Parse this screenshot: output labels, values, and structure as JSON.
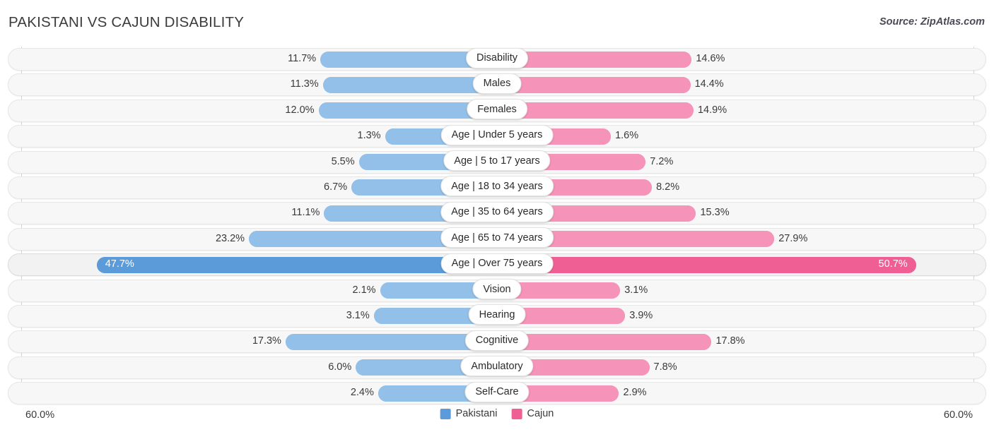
{
  "header": {
    "title": "PAKISTANI VS CAJUN DISABILITY",
    "source": "Source: ZipAtlas.com"
  },
  "axis": {
    "left_label": "60.0%",
    "right_label": "60.0%",
    "max": 60.0
  },
  "legend": {
    "items": [
      {
        "label": "Pakistani",
        "color": "#5b9bd9"
      },
      {
        "label": "Cajun",
        "color": "#f05f93"
      }
    ]
  },
  "colors": {
    "left_bar": "#93c0e8",
    "right_bar": "#f593b8",
    "left_bar_highlight": "#5b9bd9",
    "right_bar_highlight": "#f05f93",
    "track": "#f7f7f7",
    "gridline": "#d4d4d4"
  },
  "chart_data": {
    "type": "bar",
    "title": "PAKISTANI VS CAJUN DISABILITY",
    "subtitle": "Source: ZipAtlas.com",
    "orientation": "horizontal-diverging",
    "xlabel": "",
    "ylabel": "",
    "xlim": [
      60.0,
      60.0
    ],
    "grid": true,
    "legend_position": "bottom-center",
    "categories": [
      "Disability",
      "Males",
      "Females",
      "Age | Under 5 years",
      "Age | 5 to 17 years",
      "Age | 18 to 34 years",
      "Age | 35 to 64 years",
      "Age | 65 to 74 years",
      "Age | Over 75 years",
      "Vision",
      "Hearing",
      "Cognitive",
      "Ambulatory",
      "Self-Care"
    ],
    "series": [
      {
        "name": "Pakistani",
        "color": "#93c0e8",
        "values": [
          11.7,
          11.3,
          12.0,
          1.3,
          5.5,
          6.7,
          11.1,
          23.2,
          47.7,
          2.1,
          3.1,
          17.3,
          6.0,
          2.4
        ],
        "labels": [
          "11.7%",
          "11.3%",
          "12.0%",
          "1.3%",
          "5.5%",
          "6.7%",
          "11.1%",
          "23.2%",
          "47.7%",
          "2.1%",
          "3.1%",
          "17.3%",
          "6.0%",
          "2.4%"
        ]
      },
      {
        "name": "Cajun",
        "color": "#f593b8",
        "values": [
          14.6,
          14.4,
          14.9,
          1.6,
          7.2,
          8.2,
          15.3,
          27.9,
          50.7,
          3.1,
          3.9,
          17.8,
          7.8,
          2.9
        ],
        "labels": [
          "14.6%",
          "14.4%",
          "14.9%",
          "1.6%",
          "7.2%",
          "8.2%",
          "15.3%",
          "27.9%",
          "50.7%",
          "3.1%",
          "3.9%",
          "17.8%",
          "7.8%",
          "2.9%"
        ]
      }
    ],
    "highlighted_row_index": 8
  }
}
